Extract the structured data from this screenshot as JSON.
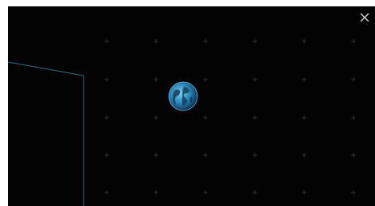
{
  "viewer": {
    "background_color": "#030303",
    "grid_marker_color": "#3a3a3a",
    "panel_outline_color": "#2f6f8f",
    "close_icon": "close-icon",
    "close_icon_color": "#cfcfcf",
    "globe_icon": "earth-globe-icon"
  }
}
